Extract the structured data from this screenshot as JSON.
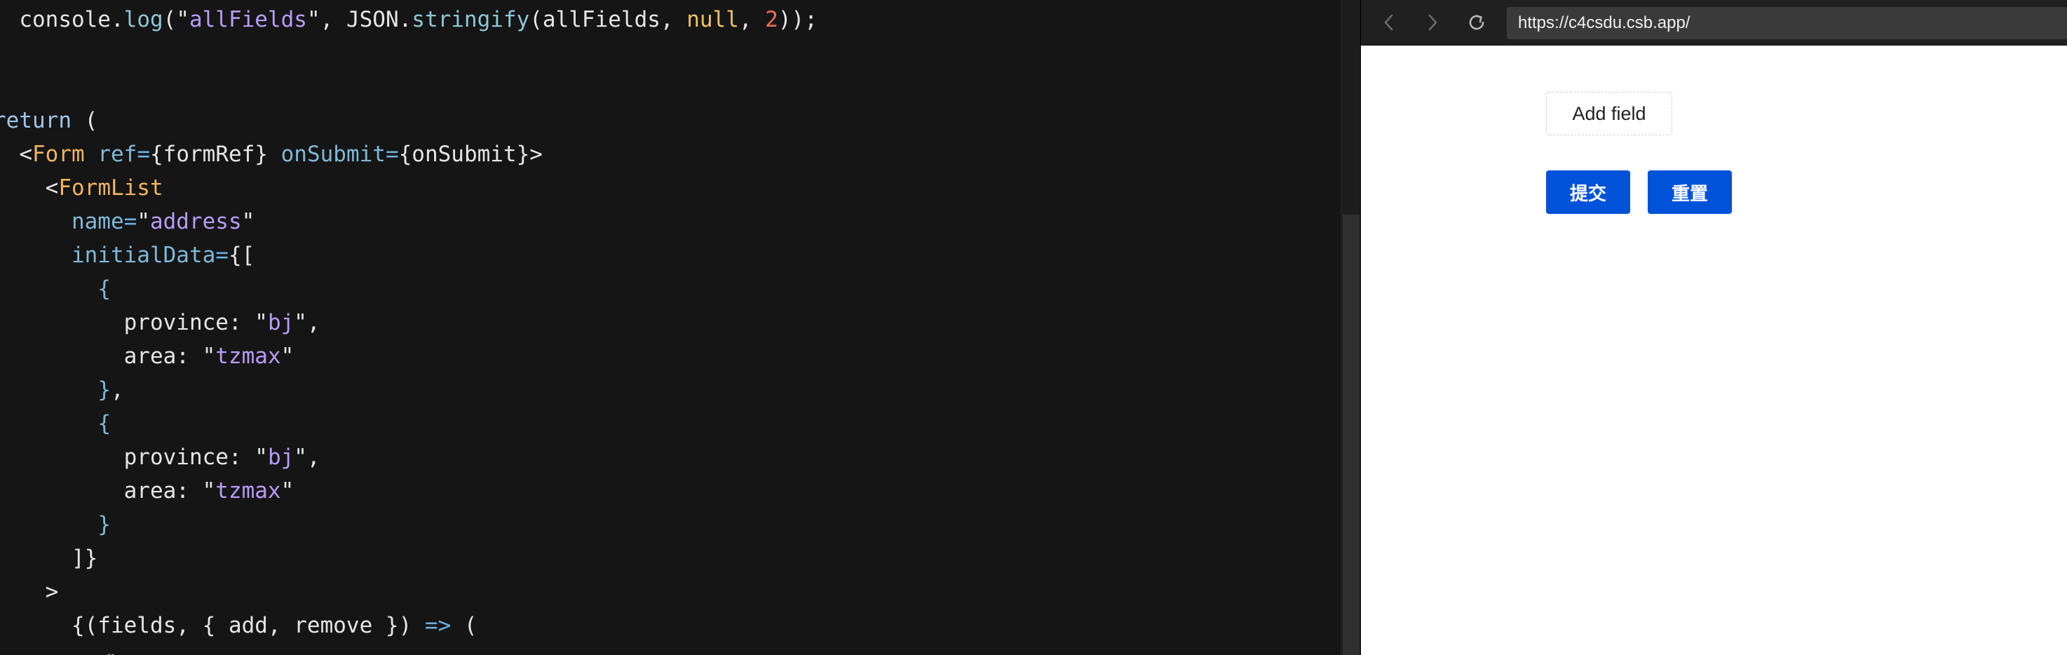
{
  "editor": {
    "lines": [
      [
        {
          "t": "  console",
          "c": "plain"
        },
        {
          "t": ".",
          "c": "punct"
        },
        {
          "t": "log",
          "c": "fn"
        },
        {
          "t": "(\"",
          "c": "punct"
        },
        {
          "t": "allFields",
          "c": "str"
        },
        {
          "t": "\", JSON.",
          "c": "punct"
        },
        {
          "t": "stringify",
          "c": "fn"
        },
        {
          "t": "(allFields, ",
          "c": "punct"
        },
        {
          "t": "null",
          "c": "null"
        },
        {
          "t": ", ",
          "c": "punct"
        },
        {
          "t": "2",
          "c": "num"
        },
        {
          "t": "));",
          "c": "punct"
        }
      ],
      [],
      [],
      [
        {
          "t": "return",
          "c": "kw"
        },
        {
          "t": " (",
          "c": "punct"
        }
      ],
      [
        {
          "t": "  <",
          "c": "punct"
        },
        {
          "t": "Form",
          "c": "tag"
        },
        {
          "t": " ",
          "c": "plain"
        },
        {
          "t": "ref",
          "c": "attr"
        },
        {
          "t": "=",
          "c": "arrow"
        },
        {
          "t": "{formRef} ",
          "c": "punct"
        },
        {
          "t": "onSubmit",
          "c": "attr"
        },
        {
          "t": "=",
          "c": "arrow"
        },
        {
          "t": "{onSubmit}>",
          "c": "punct"
        }
      ],
      [
        {
          "t": "    <",
          "c": "punct"
        },
        {
          "t": "FormList",
          "c": "tag"
        }
      ],
      [
        {
          "t": "      ",
          "c": "plain"
        },
        {
          "t": "name",
          "c": "attr"
        },
        {
          "t": "=",
          "c": "arrow"
        },
        {
          "t": "\"",
          "c": "punct"
        },
        {
          "t": "address",
          "c": "str"
        },
        {
          "t": "\"",
          "c": "punct"
        }
      ],
      [
        {
          "t": "      ",
          "c": "plain"
        },
        {
          "t": "initialData",
          "c": "attr"
        },
        {
          "t": "=",
          "c": "arrow"
        },
        {
          "t": "{[",
          "c": "punct"
        }
      ],
      [
        {
          "t": "        ",
          "c": "plain"
        },
        {
          "t": "{",
          "c": "brace"
        }
      ],
      [
        {
          "t": "          province: \"",
          "c": "punct"
        },
        {
          "t": "bj",
          "c": "str"
        },
        {
          "t": "\",",
          "c": "punct"
        }
      ],
      [
        {
          "t": "          area: \"",
          "c": "punct"
        },
        {
          "t": "tzmax",
          "c": "str"
        },
        {
          "t": "\"",
          "c": "punct"
        }
      ],
      [
        {
          "t": "        ",
          "c": "plain"
        },
        {
          "t": "}",
          "c": "brace"
        },
        {
          "t": ",",
          "c": "punct"
        }
      ],
      [
        {
          "t": "        ",
          "c": "plain"
        },
        {
          "t": "{",
          "c": "brace"
        }
      ],
      [
        {
          "t": "          province: \"",
          "c": "punct"
        },
        {
          "t": "bj",
          "c": "str"
        },
        {
          "t": "\",",
          "c": "punct"
        }
      ],
      [
        {
          "t": "          area: \"",
          "c": "punct"
        },
        {
          "t": "tzmax",
          "c": "str"
        },
        {
          "t": "\"",
          "c": "punct"
        }
      ],
      [
        {
          "t": "        ",
          "c": "plain"
        },
        {
          "t": "}",
          "c": "brace"
        }
      ],
      [
        {
          "t": "      ]}",
          "c": "punct"
        }
      ],
      [
        {
          "t": "    >",
          "c": "punct"
        }
      ],
      [
        {
          "t": "      {(fields, { add, remove }) ",
          "c": "punct"
        },
        {
          "t": "=>",
          "c": "arrow"
        },
        {
          "t": " (",
          "c": "punct"
        }
      ],
      [
        {
          "t": "        <>",
          "c": "punct"
        }
      ]
    ]
  },
  "browser": {
    "url": "https://c4csdu.csb.app/",
    "back_icon": "chevron-left-icon",
    "forward_icon": "chevron-right-icon",
    "reload_icon": "reload-icon",
    "page": {
      "add_field_label": "Add field",
      "submit_label": "提交",
      "reset_label": "重置"
    },
    "colors": {
      "primary": "#0052d9",
      "toolbar": "#202020",
      "url_bar": "#3a3a3a"
    }
  }
}
